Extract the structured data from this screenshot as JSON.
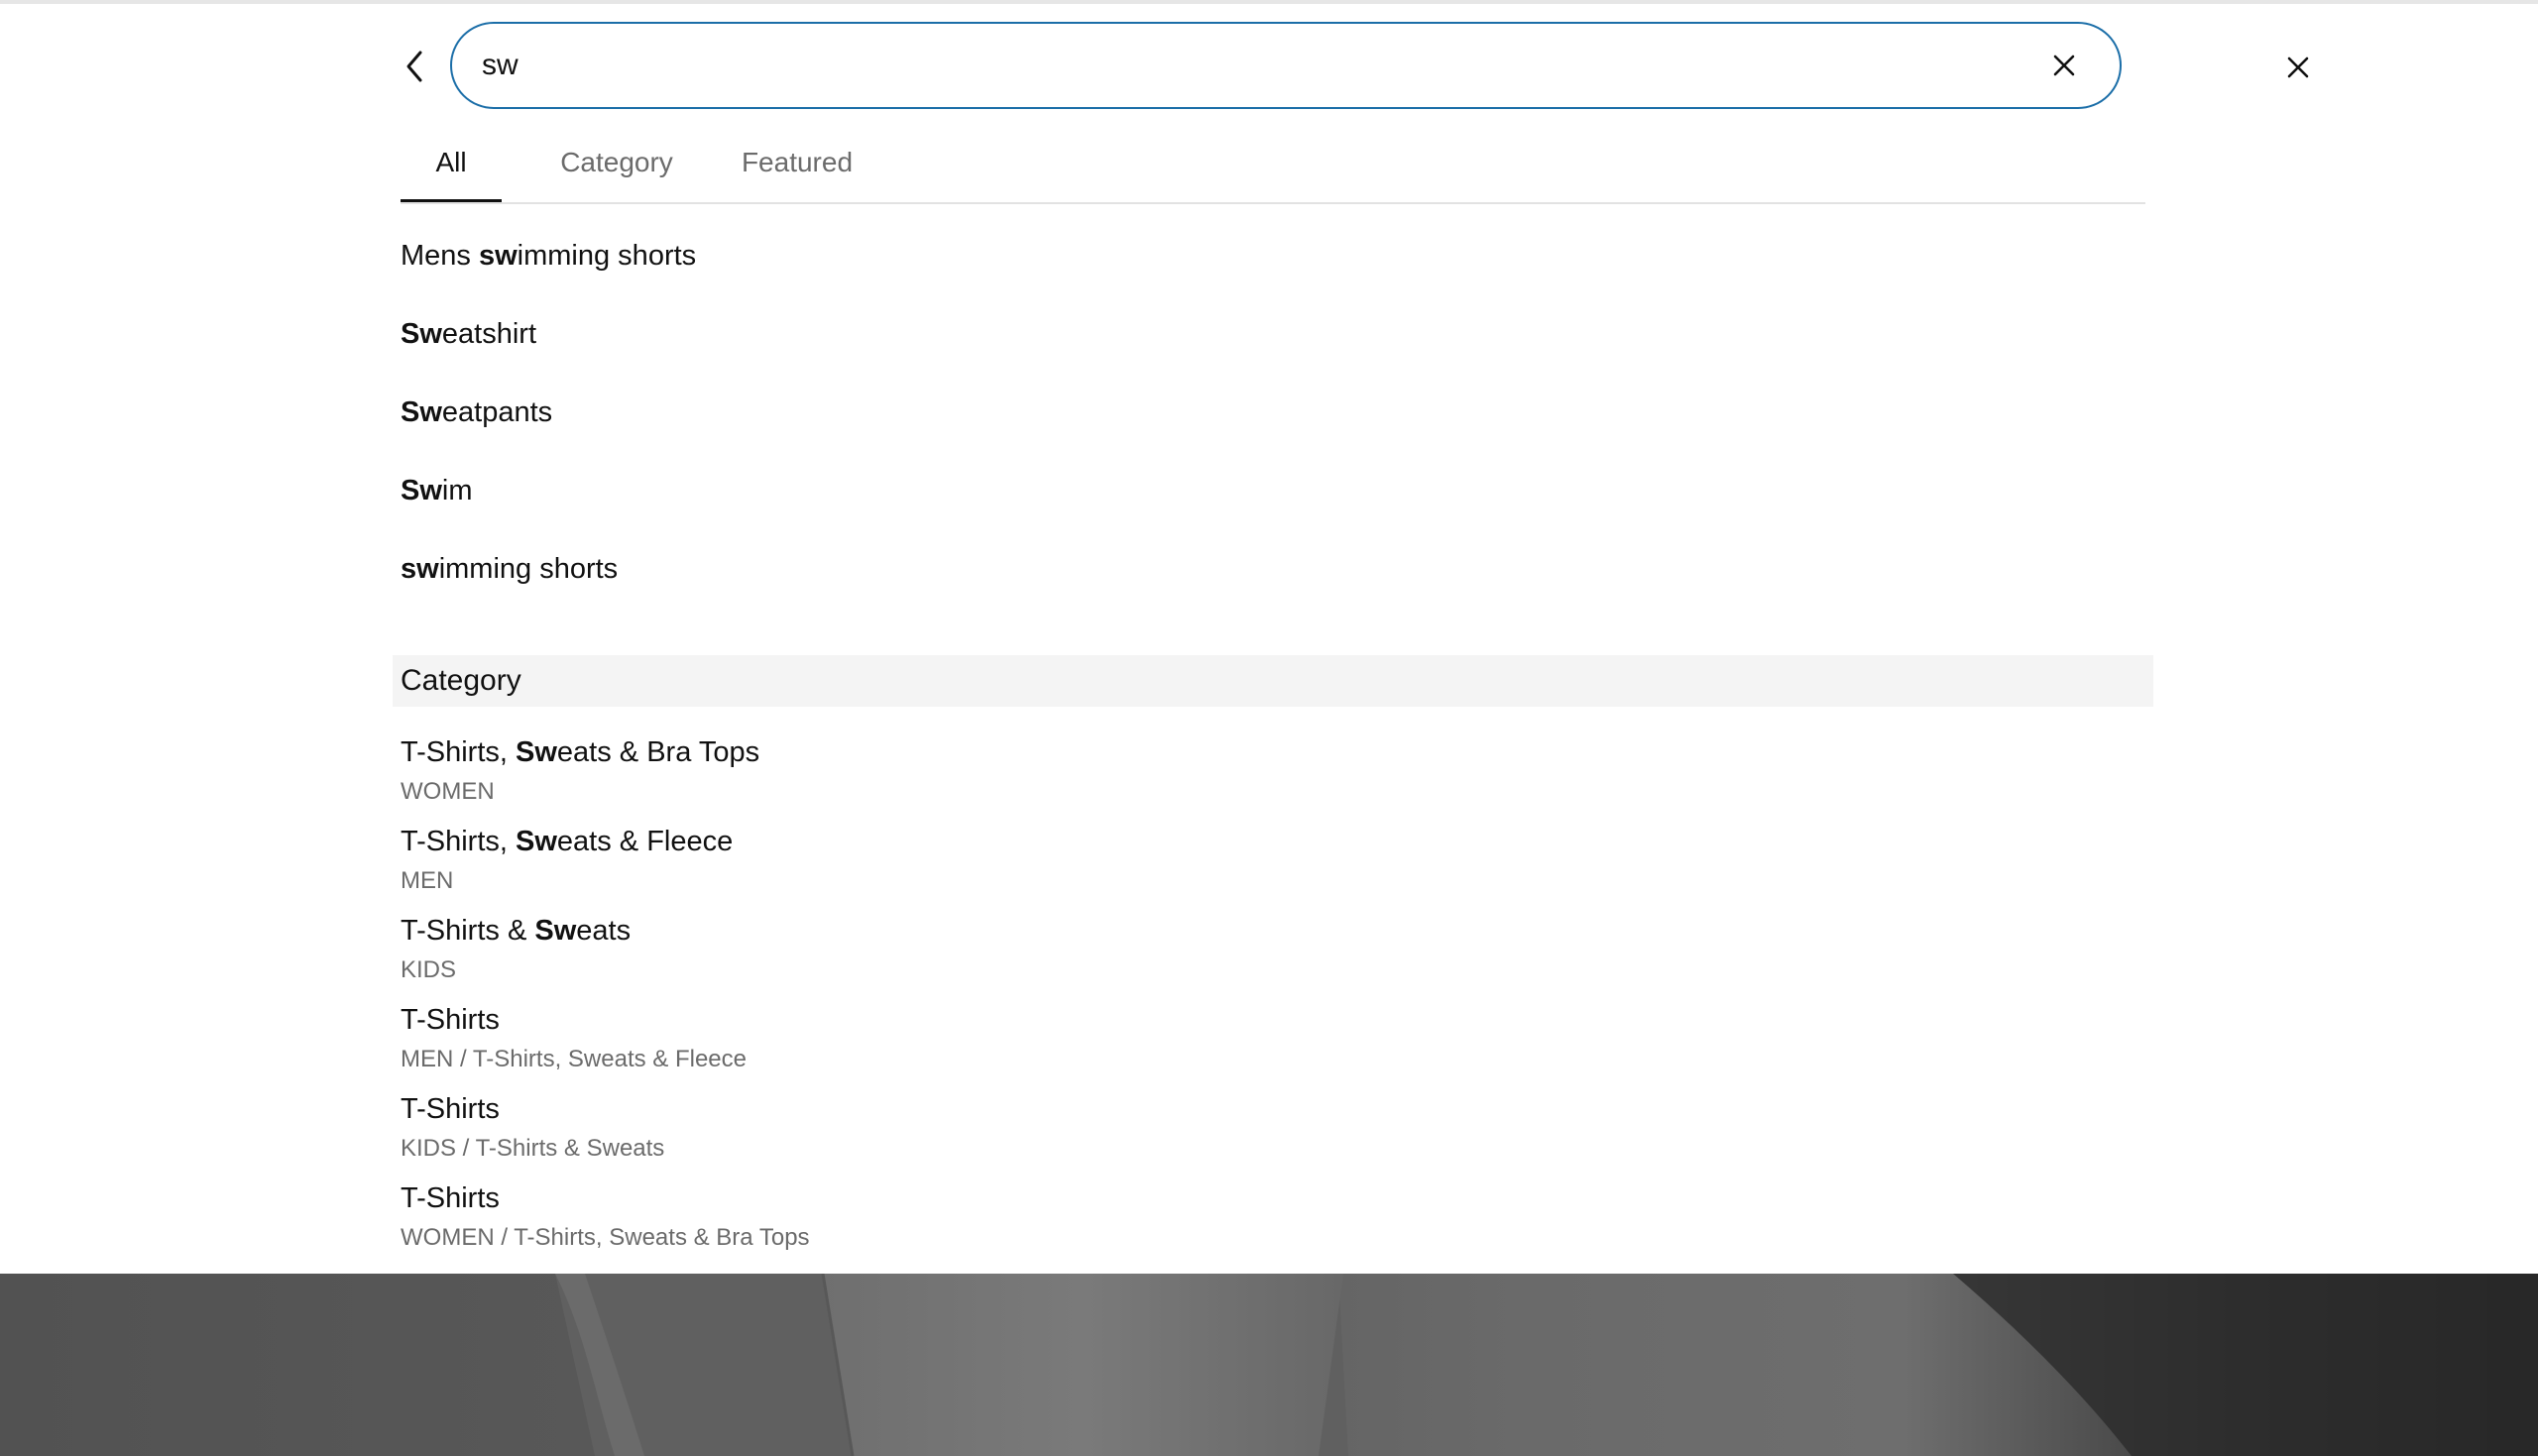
{
  "search": {
    "value": "sw",
    "placeholder": "",
    "back_icon": "chevron-left-icon",
    "clear_icon": "close-icon",
    "close_icon": "close-icon"
  },
  "tabs": [
    {
      "label": "All",
      "active": true
    },
    {
      "label": "Category",
      "active": false
    },
    {
      "label": "Featured",
      "active": false
    }
  ],
  "suggestions": [
    {
      "before": "Mens ",
      "match": "sw",
      "after": "imming shorts"
    },
    {
      "before": "",
      "match": "Sw",
      "after": "eatshirt"
    },
    {
      "before": "",
      "match": "Sw",
      "after": "eatpants"
    },
    {
      "before": "",
      "match": "Sw",
      "after": "im"
    },
    {
      "before": "",
      "match": "sw",
      "after": "imming shorts"
    }
  ],
  "category_section": {
    "heading": "Category",
    "items": [
      {
        "before": "T-Shirts, ",
        "match": "Sw",
        "after": "eats & Bra Tops",
        "sub": "WOMEN"
      },
      {
        "before": "T-Shirts, ",
        "match": "Sw",
        "after": "eats & Fleece",
        "sub": "MEN"
      },
      {
        "before": "T-Shirts & ",
        "match": "Sw",
        "after": "eats",
        "sub": "KIDS"
      },
      {
        "before": "T-Shirts",
        "match": "",
        "after": "",
        "sub": "MEN / T-Shirts, Sweats & Fleece"
      },
      {
        "before": "T-Shirts",
        "match": "",
        "after": "",
        "sub": "KIDS / T-Shirts & Sweats"
      },
      {
        "before": "T-Shirts",
        "match": "",
        "after": "",
        "sub": "WOMEN / T-Shirts, Sweats & Bra Tops"
      }
    ]
  },
  "colors": {
    "search_border": "#1b6ea8",
    "active_tab": "#111111",
    "inactive_tab": "#6b6b6b",
    "section_bg": "#f4f4f4"
  }
}
